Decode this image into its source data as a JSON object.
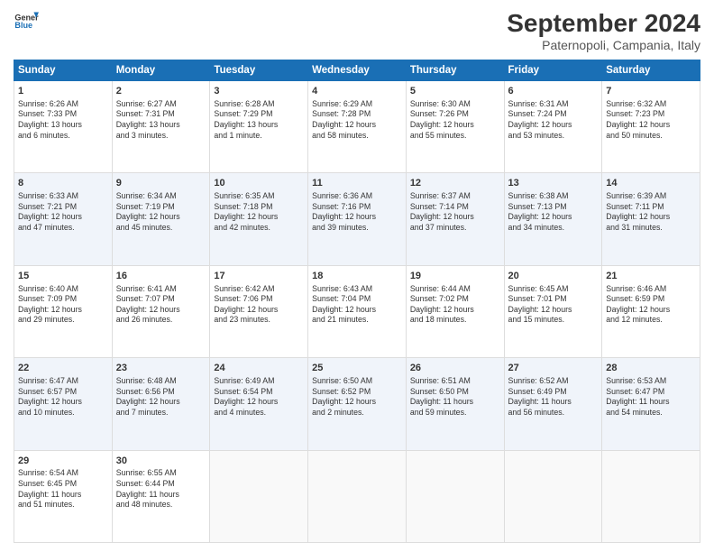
{
  "logo": {
    "line1": "General",
    "line2": "Blue"
  },
  "title": "September 2024",
  "location": "Paternopoli, Campania, Italy",
  "days_of_week": [
    "Sunday",
    "Monday",
    "Tuesday",
    "Wednesday",
    "Thursday",
    "Friday",
    "Saturday"
  ],
  "weeks": [
    [
      {
        "num": "1",
        "info": "Sunrise: 6:26 AM\nSunset: 7:33 PM\nDaylight: 13 hours\nand 6 minutes."
      },
      {
        "num": "2",
        "info": "Sunrise: 6:27 AM\nSunset: 7:31 PM\nDaylight: 13 hours\nand 3 minutes."
      },
      {
        "num": "3",
        "info": "Sunrise: 6:28 AM\nSunset: 7:29 PM\nDaylight: 13 hours\nand 1 minute."
      },
      {
        "num": "4",
        "info": "Sunrise: 6:29 AM\nSunset: 7:28 PM\nDaylight: 12 hours\nand 58 minutes."
      },
      {
        "num": "5",
        "info": "Sunrise: 6:30 AM\nSunset: 7:26 PM\nDaylight: 12 hours\nand 55 minutes."
      },
      {
        "num": "6",
        "info": "Sunrise: 6:31 AM\nSunset: 7:24 PM\nDaylight: 12 hours\nand 53 minutes."
      },
      {
        "num": "7",
        "info": "Sunrise: 6:32 AM\nSunset: 7:23 PM\nDaylight: 12 hours\nand 50 minutes."
      }
    ],
    [
      {
        "num": "8",
        "info": "Sunrise: 6:33 AM\nSunset: 7:21 PM\nDaylight: 12 hours\nand 47 minutes."
      },
      {
        "num": "9",
        "info": "Sunrise: 6:34 AM\nSunset: 7:19 PM\nDaylight: 12 hours\nand 45 minutes."
      },
      {
        "num": "10",
        "info": "Sunrise: 6:35 AM\nSunset: 7:18 PM\nDaylight: 12 hours\nand 42 minutes."
      },
      {
        "num": "11",
        "info": "Sunrise: 6:36 AM\nSunset: 7:16 PM\nDaylight: 12 hours\nand 39 minutes."
      },
      {
        "num": "12",
        "info": "Sunrise: 6:37 AM\nSunset: 7:14 PM\nDaylight: 12 hours\nand 37 minutes."
      },
      {
        "num": "13",
        "info": "Sunrise: 6:38 AM\nSunset: 7:13 PM\nDaylight: 12 hours\nand 34 minutes."
      },
      {
        "num": "14",
        "info": "Sunrise: 6:39 AM\nSunset: 7:11 PM\nDaylight: 12 hours\nand 31 minutes."
      }
    ],
    [
      {
        "num": "15",
        "info": "Sunrise: 6:40 AM\nSunset: 7:09 PM\nDaylight: 12 hours\nand 29 minutes."
      },
      {
        "num": "16",
        "info": "Sunrise: 6:41 AM\nSunset: 7:07 PM\nDaylight: 12 hours\nand 26 minutes."
      },
      {
        "num": "17",
        "info": "Sunrise: 6:42 AM\nSunset: 7:06 PM\nDaylight: 12 hours\nand 23 minutes."
      },
      {
        "num": "18",
        "info": "Sunrise: 6:43 AM\nSunset: 7:04 PM\nDaylight: 12 hours\nand 21 minutes."
      },
      {
        "num": "19",
        "info": "Sunrise: 6:44 AM\nSunset: 7:02 PM\nDaylight: 12 hours\nand 18 minutes."
      },
      {
        "num": "20",
        "info": "Sunrise: 6:45 AM\nSunset: 7:01 PM\nDaylight: 12 hours\nand 15 minutes."
      },
      {
        "num": "21",
        "info": "Sunrise: 6:46 AM\nSunset: 6:59 PM\nDaylight: 12 hours\nand 12 minutes."
      }
    ],
    [
      {
        "num": "22",
        "info": "Sunrise: 6:47 AM\nSunset: 6:57 PM\nDaylight: 12 hours\nand 10 minutes."
      },
      {
        "num": "23",
        "info": "Sunrise: 6:48 AM\nSunset: 6:56 PM\nDaylight: 12 hours\nand 7 minutes."
      },
      {
        "num": "24",
        "info": "Sunrise: 6:49 AM\nSunset: 6:54 PM\nDaylight: 12 hours\nand 4 minutes."
      },
      {
        "num": "25",
        "info": "Sunrise: 6:50 AM\nSunset: 6:52 PM\nDaylight: 12 hours\nand 2 minutes."
      },
      {
        "num": "26",
        "info": "Sunrise: 6:51 AM\nSunset: 6:50 PM\nDaylight: 11 hours\nand 59 minutes."
      },
      {
        "num": "27",
        "info": "Sunrise: 6:52 AM\nSunset: 6:49 PM\nDaylight: 11 hours\nand 56 minutes."
      },
      {
        "num": "28",
        "info": "Sunrise: 6:53 AM\nSunset: 6:47 PM\nDaylight: 11 hours\nand 54 minutes."
      }
    ],
    [
      {
        "num": "29",
        "info": "Sunrise: 6:54 AM\nSunset: 6:45 PM\nDaylight: 11 hours\nand 51 minutes."
      },
      {
        "num": "30",
        "info": "Sunrise: 6:55 AM\nSunset: 6:44 PM\nDaylight: 11 hours\nand 48 minutes."
      },
      {
        "num": "",
        "info": ""
      },
      {
        "num": "",
        "info": ""
      },
      {
        "num": "",
        "info": ""
      },
      {
        "num": "",
        "info": ""
      },
      {
        "num": "",
        "info": ""
      }
    ]
  ]
}
